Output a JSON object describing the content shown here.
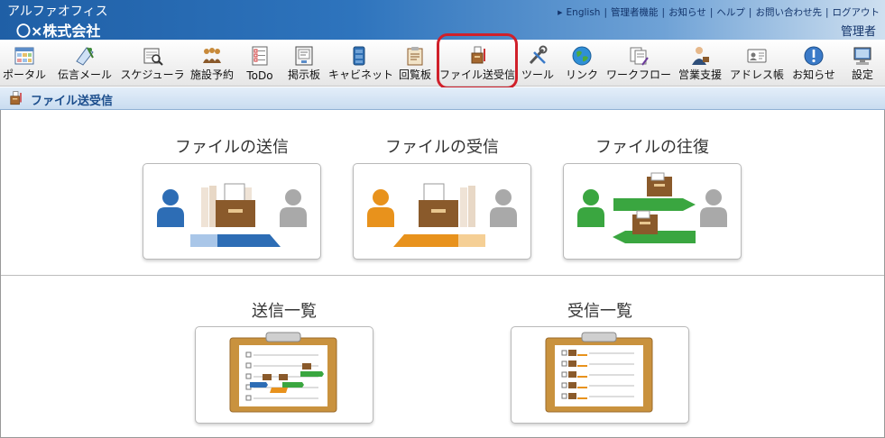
{
  "header": {
    "app_name": "アルファオフィス",
    "company": "〇×株式会社",
    "links": [
      "English",
      "管理者機能",
      "お知らせ",
      "ヘルプ",
      "お問い合わせ先",
      "ログアウト"
    ],
    "user": "管理者"
  },
  "toolbar": {
    "items": [
      {
        "label": "ポータル",
        "icon": "portal-icon"
      },
      {
        "label": "伝言メール",
        "icon": "message-mail-icon"
      },
      {
        "label": "スケジューラ",
        "icon": "scheduler-icon"
      },
      {
        "label": "施設予約",
        "icon": "facility-reservation-icon"
      },
      {
        "label": "ToDo",
        "icon": "todo-icon"
      },
      {
        "label": "掲示板",
        "icon": "bulletin-board-icon"
      },
      {
        "label": "キャビネット",
        "icon": "cabinet-icon"
      },
      {
        "label": "回覧板",
        "icon": "circular-icon"
      },
      {
        "label": "ファイル送受信",
        "icon": "file-transfer-icon"
      },
      {
        "label": "ツール",
        "icon": "tools-icon"
      },
      {
        "label": "リンク",
        "icon": "link-globe-icon"
      },
      {
        "label": "ワークフロー",
        "icon": "workflow-icon"
      },
      {
        "label": "営業支援",
        "icon": "sales-support-icon"
      },
      {
        "label": "アドレス帳",
        "icon": "address-book-icon"
      },
      {
        "label": "お知らせ",
        "icon": "notice-icon"
      },
      {
        "label": "設定",
        "icon": "settings-icon"
      }
    ]
  },
  "section": {
    "title": "ファイル送受信"
  },
  "cards": {
    "send": "ファイルの送信",
    "receive": "ファイルの受信",
    "roundtrip": "ファイルの往復",
    "sent_list": "送信一覧",
    "received_list": "受信一覧"
  },
  "colors": {
    "header_dark": "#1f5fa6",
    "highlight": "#d0202a",
    "send_blue": "#2d6db5",
    "receive_orange": "#e8921c",
    "roundtrip_green": "#3aa640",
    "person_gray": "#a9a9a9",
    "box_brown": "#8a5a2b",
    "clipboard": "#c9923e"
  }
}
